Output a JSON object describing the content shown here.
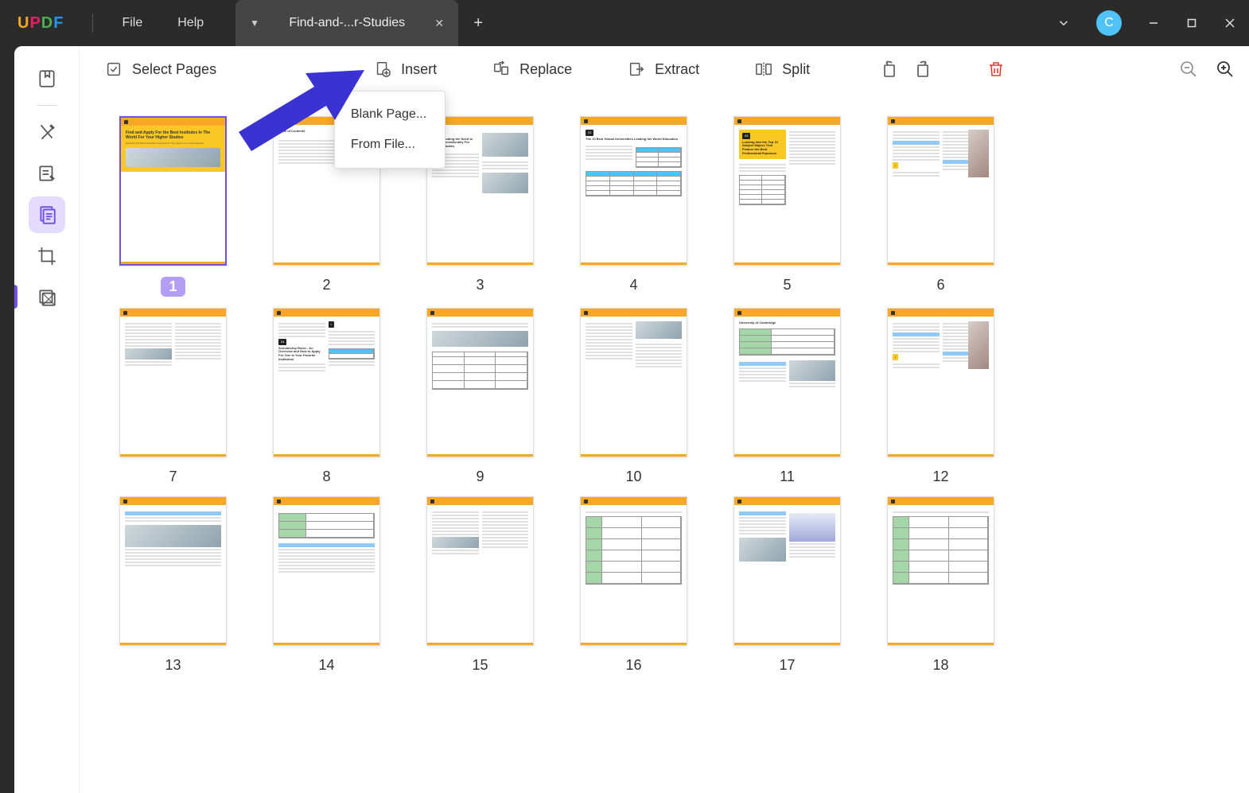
{
  "menus": {
    "file": "File",
    "help": "Help"
  },
  "tab": {
    "name": "Find-and-...r-Studies"
  },
  "avatar": "C",
  "toolbar": {
    "select_pages": "Select Pages",
    "insert": "Insert",
    "replace": "Replace",
    "extract": "Extract",
    "split": "Split"
  },
  "dropdown": {
    "blank_page": "Blank Page...",
    "from_file": "From File..."
  },
  "pages": [
    "1",
    "2",
    "3",
    "4",
    "5",
    "6",
    "7",
    "8",
    "9",
    "10",
    "11",
    "12",
    "13",
    "14",
    "15",
    "16",
    "17",
    "18"
  ],
  "selected_page": "1",
  "page_content": {
    "1": "Find and Apply For the Best Institutes In The World For Your Higher Studies",
    "2": "Table of Contents",
    "3": "Understanding the Need to Apply Internationally For Higher Studies",
    "4": "The 10 Best Global Universities Leading the World Education",
    "5": "Looking Into the Top 10 Subject Majors That Feature the Best Professional Exposure",
    "8": "Scholarship Rules - An Overview and How to Apply For One In Your Favorite Institution",
    "11": "University of Cambridge"
  }
}
